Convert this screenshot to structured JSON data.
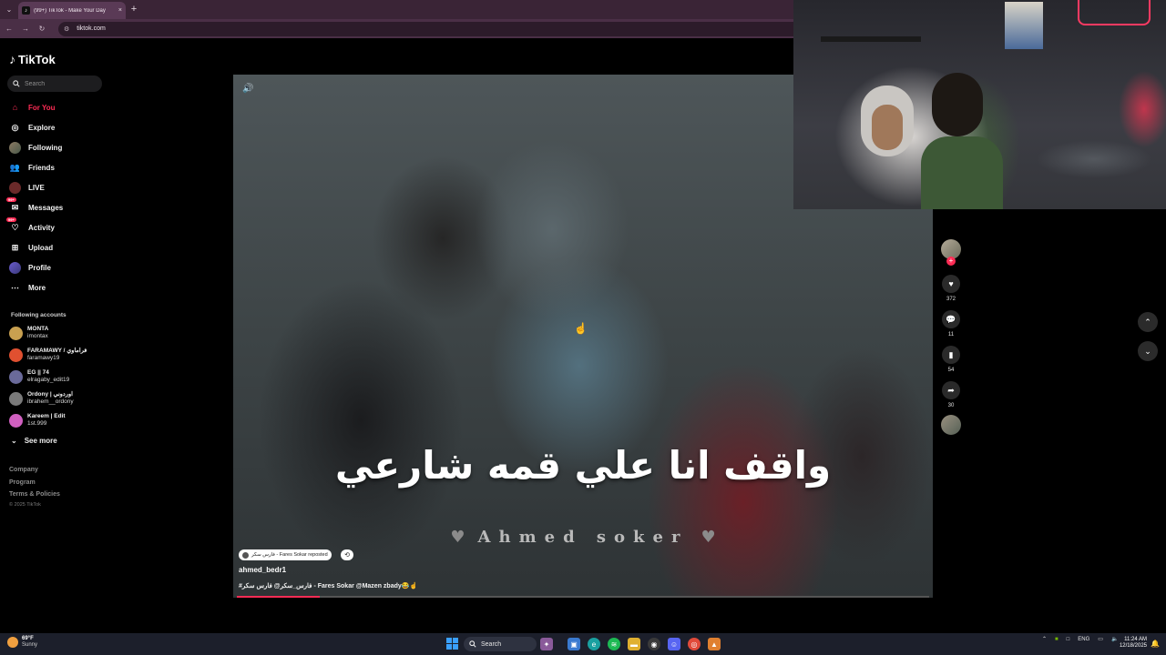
{
  "browser": {
    "tab_title": "(99+) TikTok - Make Your Day",
    "url": "tiktok.com",
    "new_tab": "+",
    "tab_close": "×"
  },
  "sidebar": {
    "logo": "TikTok",
    "search_placeholder": "Search",
    "nav": [
      {
        "label": "For You",
        "icon": "home-icon"
      },
      {
        "label": "Explore",
        "icon": "compass-icon"
      },
      {
        "label": "Following",
        "icon": "following-avatar-icon"
      },
      {
        "label": "Friends",
        "icon": "friends-icon"
      },
      {
        "label": "LIVE",
        "icon": "live-icon"
      },
      {
        "label": "Messages",
        "icon": "messages-icon",
        "badge": "99+"
      },
      {
        "label": "Activity",
        "icon": "activity-icon",
        "badge": "99+"
      },
      {
        "label": "Upload",
        "icon": "upload-icon"
      },
      {
        "label": "Profile",
        "icon": "profile-icon"
      },
      {
        "label": "More",
        "icon": "more-icon"
      }
    ],
    "following_heading": "Following accounts",
    "accounts": [
      {
        "name": "MONTA",
        "handle": "imontax",
        "color": "#c8a050"
      },
      {
        "name": "FARAMAWY / فراماوي",
        "handle": "faramawy19",
        "color": "#e05030"
      },
      {
        "name": "EG || 74",
        "handle": "elragaby_edit19",
        "color": "#6a6a9a"
      },
      {
        "name": "Ordony | اوردوني",
        "handle": "ibrahem__ordony",
        "color": "#7a7a7a"
      },
      {
        "name": "Kareem | Edit",
        "handle": "1st.999",
        "color": "#d060c0"
      }
    ],
    "see_more": "See more",
    "footer": [
      "Company",
      "Program",
      "Terms & Policies"
    ],
    "copyright": "© 2025 TikTok"
  },
  "video": {
    "caption_ar": "واقف انا علي قمه شارعي",
    "watermark": "Ahmed soker",
    "repost_label": "فارس سكر - Fares Sokar reposted",
    "author": "ahmed_bedr1",
    "description": "#فارس_سكر@ فارس سكر - Fares Sokar @Mazen zbady😂☝",
    "progress": 0.12
  },
  "actions": {
    "likes": "372",
    "comments": "11",
    "saves": "54",
    "shares": "30"
  },
  "taskbar": {
    "temp": "69°F",
    "condition": "Sunny",
    "search": "Search",
    "lang": "ENG",
    "time": "11:24 AM",
    "date": "12/18/2025"
  },
  "colors": {
    "accent": "#fe2c55",
    "tab_bar": "#3a2436",
    "address_bar": "#4a2f46",
    "taskbar": "#1c1f2b"
  }
}
